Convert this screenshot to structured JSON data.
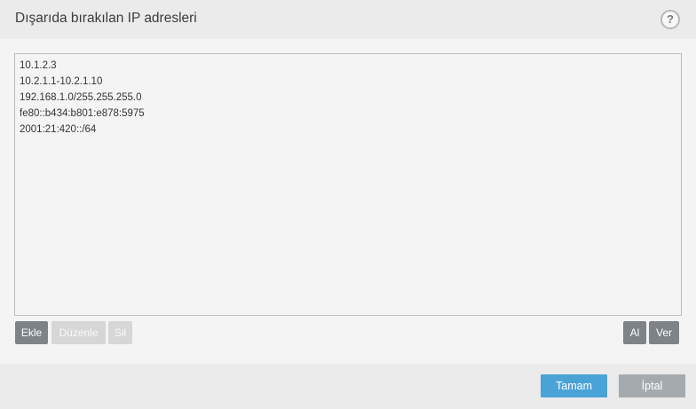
{
  "dialog": {
    "title": "Dışarıda bırakılan IP adresleri",
    "help_label": "?"
  },
  "list": {
    "items": [
      "10.1.2.3",
      "10.2.1.1-10.2.1.10",
      "192.168.1.0/255.255.255.0",
      "fe80::b434:b801:e878:5975",
      "2001:21:420::/64"
    ]
  },
  "toolbar": {
    "add_label": "Ekle",
    "edit_label": "Düzenle",
    "delete_label": "Sil",
    "import_label": "Al",
    "export_label": "Ver"
  },
  "footer": {
    "ok_label": "Tamam",
    "cancel_label": "İptal"
  },
  "colors": {
    "primary": "#4aa3d7",
    "dark_button": "#7e8388",
    "disabled_button": "#d6d6d6"
  }
}
